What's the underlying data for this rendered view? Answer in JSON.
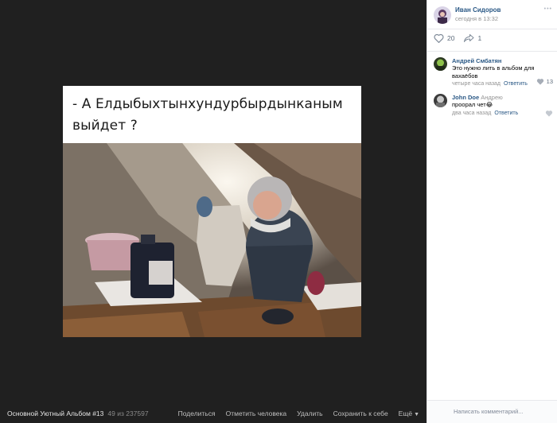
{
  "post": {
    "caption": "- А Елдыбыхтынхундурбырдынканым выйдет ?"
  },
  "album": {
    "title": "Основной Уютный Альбом #13",
    "counter": "49 из 237597"
  },
  "actions": [
    "Поделиться",
    "Отметить человека",
    "Удалить",
    "Сохранить к себе",
    "Ещё"
  ],
  "author": {
    "name": "Иван Сидоров",
    "time": "сегодня в 13:32"
  },
  "stats": {
    "likes": "20",
    "shares": "1"
  },
  "comments": [
    {
      "author": "Андрей Смбатян",
      "reply_to": "",
      "text": "Это нужно лить в альбом для вахаёбов",
      "time": "четыре часа назад",
      "reply_label": "Ответить",
      "likes": "13"
    },
    {
      "author": "John Doe",
      "reply_to": "Андрею",
      "text": "проорал чет😂",
      "time": "два часа назад",
      "reply_label": "Ответить",
      "likes": ""
    }
  ],
  "comment_input": {
    "placeholder": "Написать комментарий..."
  },
  "colors": {
    "viewer_bg": "#202020",
    "link_blue": "#2a5885",
    "muted": "#939393"
  }
}
